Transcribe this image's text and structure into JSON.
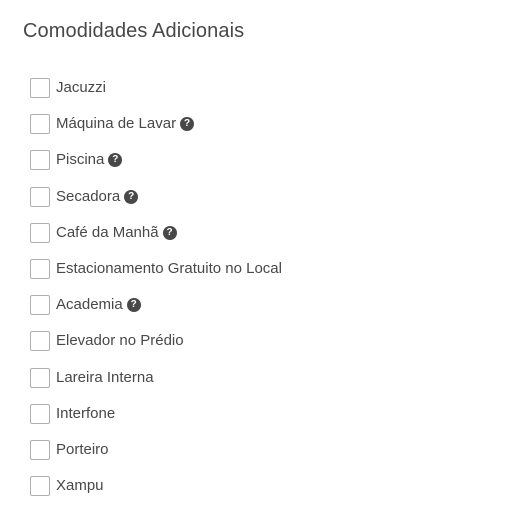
{
  "section": {
    "title": "Comodidades Adicionais"
  },
  "amenities": [
    {
      "label": "Jacuzzi",
      "checked": false,
      "has_help": false
    },
    {
      "label": "Máquina de Lavar",
      "checked": false,
      "has_help": true
    },
    {
      "label": "Piscina",
      "checked": false,
      "has_help": true
    },
    {
      "label": "Secadora",
      "checked": false,
      "has_help": true
    },
    {
      "label": "Café da Manhã",
      "checked": false,
      "has_help": true
    },
    {
      "label": "Estacionamento Gratuito no Local",
      "checked": false,
      "has_help": false
    },
    {
      "label": "Academia",
      "checked": false,
      "has_help": true
    },
    {
      "label": "Elevador no Prédio",
      "checked": false,
      "has_help": false
    },
    {
      "label": "Lareira Interna",
      "checked": false,
      "has_help": false
    },
    {
      "label": "Interfone",
      "checked": false,
      "has_help": false
    },
    {
      "label": "Porteiro",
      "checked": false,
      "has_help": false
    },
    {
      "label": "Xampu",
      "checked": false,
      "has_help": false
    }
  ],
  "icons": {
    "help_glyph": "?"
  },
  "colors": {
    "text": "#484848",
    "checkbox_border": "#b0b0b0",
    "help_icon_bg": "#484848"
  }
}
